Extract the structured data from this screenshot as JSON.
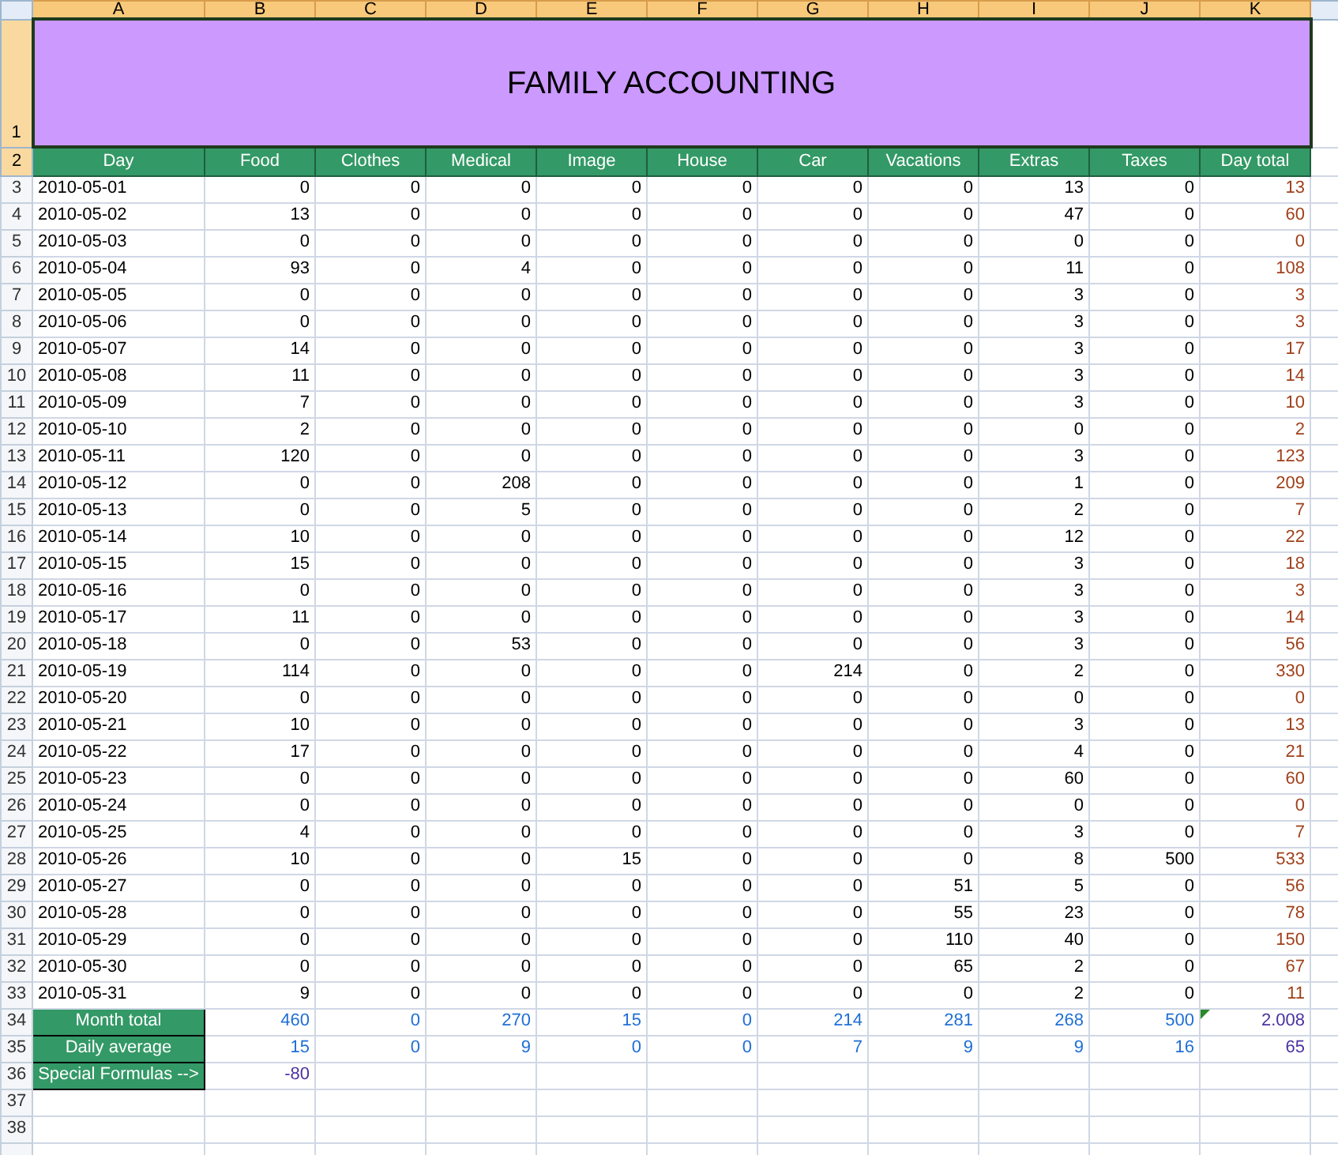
{
  "column_headers": [
    {
      "label": "A",
      "selected": true
    },
    {
      "label": "B",
      "selected": true
    },
    {
      "label": "C",
      "selected": true
    },
    {
      "label": "D",
      "selected": true
    },
    {
      "label": "E",
      "selected": true
    },
    {
      "label": "F",
      "selected": true
    },
    {
      "label": "G",
      "selected": true
    },
    {
      "label": "H",
      "selected": true
    },
    {
      "label": "I",
      "selected": true
    },
    {
      "label": "J",
      "selected": true
    },
    {
      "label": "K",
      "selected": true
    }
  ],
  "title": {
    "row": "1",
    "row_selected": true,
    "text": "FAMILY ACCOUNTING"
  },
  "header": {
    "row": "2",
    "row_selected": true,
    "cells": [
      "Day",
      "Food",
      "Clothes",
      "Medical",
      "Image",
      "House",
      "Car",
      "Vacations",
      "Extras",
      "Taxes",
      "Day total"
    ]
  },
  "rows": [
    {
      "row": "3",
      "cells": [
        "2010-05-01",
        "0",
        "0",
        "0",
        "0",
        "0",
        "0",
        "0",
        "13",
        "0",
        "13"
      ]
    },
    {
      "row": "4",
      "cells": [
        "2010-05-02",
        "13",
        "0",
        "0",
        "0",
        "0",
        "0",
        "0",
        "47",
        "0",
        "60"
      ]
    },
    {
      "row": "5",
      "cells": [
        "2010-05-03",
        "0",
        "0",
        "0",
        "0",
        "0",
        "0",
        "0",
        "0",
        "0",
        "0"
      ]
    },
    {
      "row": "6",
      "cells": [
        "2010-05-04",
        "93",
        "0",
        "4",
        "0",
        "0",
        "0",
        "0",
        "11",
        "0",
        "108"
      ]
    },
    {
      "row": "7",
      "cells": [
        "2010-05-05",
        "0",
        "0",
        "0",
        "0",
        "0",
        "0",
        "0",
        "3",
        "0",
        "3"
      ]
    },
    {
      "row": "8",
      "cells": [
        "2010-05-06",
        "0",
        "0",
        "0",
        "0",
        "0",
        "0",
        "0",
        "3",
        "0",
        "3"
      ]
    },
    {
      "row": "9",
      "cells": [
        "2010-05-07",
        "14",
        "0",
        "0",
        "0",
        "0",
        "0",
        "0",
        "3",
        "0",
        "17"
      ]
    },
    {
      "row": "10",
      "cells": [
        "2010-05-08",
        "11",
        "0",
        "0",
        "0",
        "0",
        "0",
        "0",
        "3",
        "0",
        "14"
      ]
    },
    {
      "row": "11",
      "cells": [
        "2010-05-09",
        "7",
        "0",
        "0",
        "0",
        "0",
        "0",
        "0",
        "3",
        "0",
        "10"
      ]
    },
    {
      "row": "12",
      "cells": [
        "2010-05-10",
        "2",
        "0",
        "0",
        "0",
        "0",
        "0",
        "0",
        "0",
        "0",
        "2"
      ]
    },
    {
      "row": "13",
      "cells": [
        "2010-05-11",
        "120",
        "0",
        "0",
        "0",
        "0",
        "0",
        "0",
        "3",
        "0",
        "123"
      ]
    },
    {
      "row": "14",
      "cells": [
        "2010-05-12",
        "0",
        "0",
        "208",
        "0",
        "0",
        "0",
        "0",
        "1",
        "0",
        "209"
      ]
    },
    {
      "row": "15",
      "cells": [
        "2010-05-13",
        "0",
        "0",
        "5",
        "0",
        "0",
        "0",
        "0",
        "2",
        "0",
        "7"
      ]
    },
    {
      "row": "16",
      "cells": [
        "2010-05-14",
        "10",
        "0",
        "0",
        "0",
        "0",
        "0",
        "0",
        "12",
        "0",
        "22"
      ]
    },
    {
      "row": "17",
      "cells": [
        "2010-05-15",
        "15",
        "0",
        "0",
        "0",
        "0",
        "0",
        "0",
        "3",
        "0",
        "18"
      ]
    },
    {
      "row": "18",
      "cells": [
        "2010-05-16",
        "0",
        "0",
        "0",
        "0",
        "0",
        "0",
        "0",
        "3",
        "0",
        "3"
      ]
    },
    {
      "row": "19",
      "cells": [
        "2010-05-17",
        "11",
        "0",
        "0",
        "0",
        "0",
        "0",
        "0",
        "3",
        "0",
        "14"
      ]
    },
    {
      "row": "20",
      "cells": [
        "2010-05-18",
        "0",
        "0",
        "53",
        "0",
        "0",
        "0",
        "0",
        "3",
        "0",
        "56"
      ]
    },
    {
      "row": "21",
      "cells": [
        "2010-05-19",
        "114",
        "0",
        "0",
        "0",
        "0",
        "214",
        "0",
        "2",
        "0",
        "330"
      ]
    },
    {
      "row": "22",
      "cells": [
        "2010-05-20",
        "0",
        "0",
        "0",
        "0",
        "0",
        "0",
        "0",
        "0",
        "0",
        "0"
      ]
    },
    {
      "row": "23",
      "cells": [
        "2010-05-21",
        "10",
        "0",
        "0",
        "0",
        "0",
        "0",
        "0",
        "3",
        "0",
        "13"
      ]
    },
    {
      "row": "24",
      "cells": [
        "2010-05-22",
        "17",
        "0",
        "0",
        "0",
        "0",
        "0",
        "0",
        "4",
        "0",
        "21"
      ]
    },
    {
      "row": "25",
      "cells": [
        "2010-05-23",
        "0",
        "0",
        "0",
        "0",
        "0",
        "0",
        "0",
        "60",
        "0",
        "60"
      ]
    },
    {
      "row": "26",
      "cells": [
        "2010-05-24",
        "0",
        "0",
        "0",
        "0",
        "0",
        "0",
        "0",
        "0",
        "0",
        "0"
      ]
    },
    {
      "row": "27",
      "cells": [
        "2010-05-25",
        "4",
        "0",
        "0",
        "0",
        "0",
        "0",
        "0",
        "3",
        "0",
        "7"
      ]
    },
    {
      "row": "28",
      "cells": [
        "2010-05-26",
        "10",
        "0",
        "0",
        "15",
        "0",
        "0",
        "0",
        "8",
        "500",
        "533"
      ]
    },
    {
      "row": "29",
      "cells": [
        "2010-05-27",
        "0",
        "0",
        "0",
        "0",
        "0",
        "0",
        "51",
        "5",
        "0",
        "56"
      ]
    },
    {
      "row": "30",
      "cells": [
        "2010-05-28",
        "0",
        "0",
        "0",
        "0",
        "0",
        "0",
        "55",
        "23",
        "0",
        "78"
      ]
    },
    {
      "row": "31",
      "cells": [
        "2010-05-29",
        "0",
        "0",
        "0",
        "0",
        "0",
        "0",
        "110",
        "40",
        "0",
        "150"
      ]
    },
    {
      "row": "32",
      "cells": [
        "2010-05-30",
        "0",
        "0",
        "0",
        "0",
        "0",
        "0",
        "65",
        "2",
        "0",
        "67"
      ]
    },
    {
      "row": "33",
      "cells": [
        "2010-05-31",
        "9",
        "0",
        "0",
        "0",
        "0",
        "0",
        "0",
        "2",
        "0",
        "11"
      ]
    }
  ],
  "summary": [
    {
      "row": "34",
      "label": "Month total",
      "warning": true,
      "cells": [
        "460",
        "0",
        "270",
        "15",
        "0",
        "214",
        "281",
        "268",
        "500",
        "2.008"
      ]
    },
    {
      "row": "35",
      "label": "Daily average",
      "warning": false,
      "cells": [
        "15",
        "0",
        "9",
        "0",
        "0",
        "7",
        "9",
        "9",
        "16",
        "65"
      ]
    },
    {
      "row": "36",
      "label": "Special Formulas -->",
      "warning": false,
      "cells": [
        "-80"
      ]
    }
  ],
  "empty_rows": [
    "37",
    "38"
  ]
}
